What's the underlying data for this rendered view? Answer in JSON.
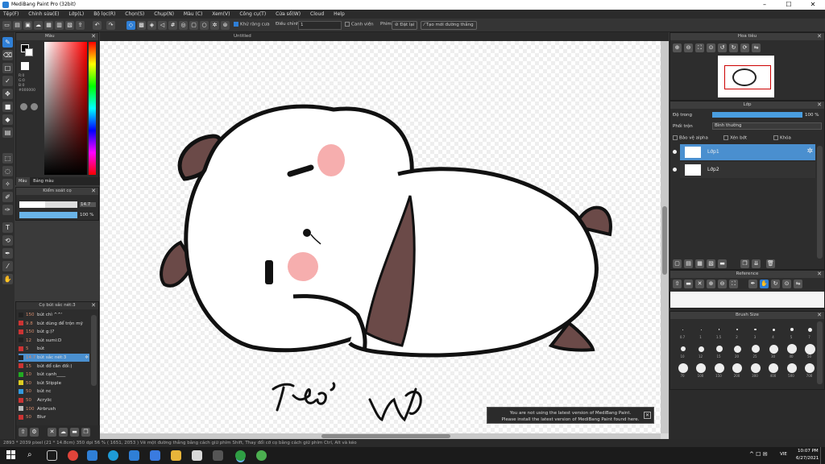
{
  "window": {
    "title": "MediBang Paint Pro (32bit)",
    "min": "–",
    "max": "☐",
    "close": "✕"
  },
  "menu": [
    "Tệp(F)",
    "Chỉnh sửa(E)",
    "Lớp(L)",
    "Bộ lọc(R)",
    "Chọn(S)",
    "Chụp(N)",
    "Màu (C)",
    "Xem(V)",
    "Công cụ(T)",
    "Cửa sổ(W)",
    "Cloud",
    "Help"
  ],
  "toolbar": {
    "antialias_label": "Khử răng cưa",
    "correction_label": "Điều chỉnh",
    "correction_value": "1",
    "edge_label": "Canh viền",
    "snap_label": "Phím",
    "snap_off": "Đặt lại",
    "new_ruler": "Tạo mới đường thẳng"
  },
  "color_panel": {
    "title": "Màu",
    "rgb": [
      "R:0",
      "G:0",
      "B:0"
    ],
    "hex": "#000000",
    "tabs": [
      "Màu",
      "Bảng màu"
    ],
    "primary_color": "#000000",
    "secondary_color": "#ffffff"
  },
  "brush_control": {
    "title": "Kiểm soát cọ",
    "size_value": "14.7",
    "opacity_value": "100 %",
    "size_fraction": 0.45,
    "opacity_fraction": 1.0
  },
  "brush_list": {
    "title": "Cọ bút sắc nét:3",
    "items": [
      {
        "size": "150",
        "name": "bút chì ^^'",
        "color": "#222222",
        "selected": false
      },
      {
        "size": "9.8",
        "name": "bút dùng để trộn mỹ",
        "color": "#cc3333",
        "selected": false
      },
      {
        "size": "150",
        "name": "bút g:)?",
        "color": "#cc3333",
        "selected": false
      },
      {
        "size": "12",
        "name": "bút sumi:D",
        "color": "#222222",
        "selected": false
      },
      {
        "size": "5",
        "name": "bút",
        "color": "#cc3333",
        "selected": false
      },
      {
        "size": "14.7",
        "name": "bút sắc nét:3",
        "color": "#222222",
        "selected": true
      },
      {
        "size": "15",
        "name": "bút đổ cân đối:)",
        "color": "#cc3333",
        "selected": false
      },
      {
        "size": "10",
        "name": "bút cạnh____",
        "color": "#22aa22",
        "selected": false
      },
      {
        "size": "50",
        "name": "bút Stipple",
        "color": "#ddcc22",
        "selected": false
      },
      {
        "size": "50",
        "name": "bút nc",
        "color": "#3399dd",
        "selected": false
      },
      {
        "size": "50",
        "name": "Acrylic",
        "color": "#cc3333",
        "selected": false
      },
      {
        "size": "100",
        "name": "Airbrush",
        "color": "#bbbbbb",
        "selected": false
      },
      {
        "size": "50",
        "name": "Blur",
        "color": "#cc3333",
        "selected": false
      }
    ]
  },
  "canvas": {
    "tab_title": "Untitled",
    "handwriting": "Thỏ ˊ ƜƊ"
  },
  "notice": {
    "line1": "You are not using the latest version of MediBang Paint.",
    "line2": "Please install the latest version of MediBang Paint found here."
  },
  "statusbar": {
    "text": "2893 * 2039 pixel  (21 * 14.8cm)  350 dpi  56 %  ( 1651, 2053 )  Vẽ một đường thẳng bằng cách giữ phím Shift, Thay đổi cỡ cọ bằng cách giữ phím Ctrl, Alt và kéo"
  },
  "navigator": {
    "title": "Hoa tiêu"
  },
  "layers": {
    "title": "Lớp",
    "opacity_label": "Độ trong",
    "opacity_value": "100 %",
    "blend_label": "Phối trộn",
    "blend_value": "Bình thường",
    "protect_alpha": "Bảo vệ alpha",
    "clipping": "Xén bớt",
    "lock": "Khóa",
    "items": [
      {
        "name": "Lớp1",
        "selected": true
      },
      {
        "name": "Lớp2",
        "selected": false
      }
    ]
  },
  "reference": {
    "title": "Reference"
  },
  "brush_size": {
    "title": "Brush Size",
    "rows": [
      [
        "0.7",
        "1",
        "1.5",
        "2",
        "3",
        "4",
        "5",
        "7"
      ],
      [
        "10",
        "12",
        "15",
        "20",
        "25",
        "30",
        "40",
        "50"
      ],
      [
        "70",
        "100",
        "150",
        "200",
        "300",
        "400",
        "500",
        "700"
      ]
    ]
  },
  "taskbar": {
    "time": "10:07 PM",
    "date": "6/27/2021",
    "lang": "VIE"
  },
  "colors": {
    "accent": "#2f7fd6",
    "pink_cheek": "#f4a0a0",
    "ear_brown": "#6b4a48"
  }
}
